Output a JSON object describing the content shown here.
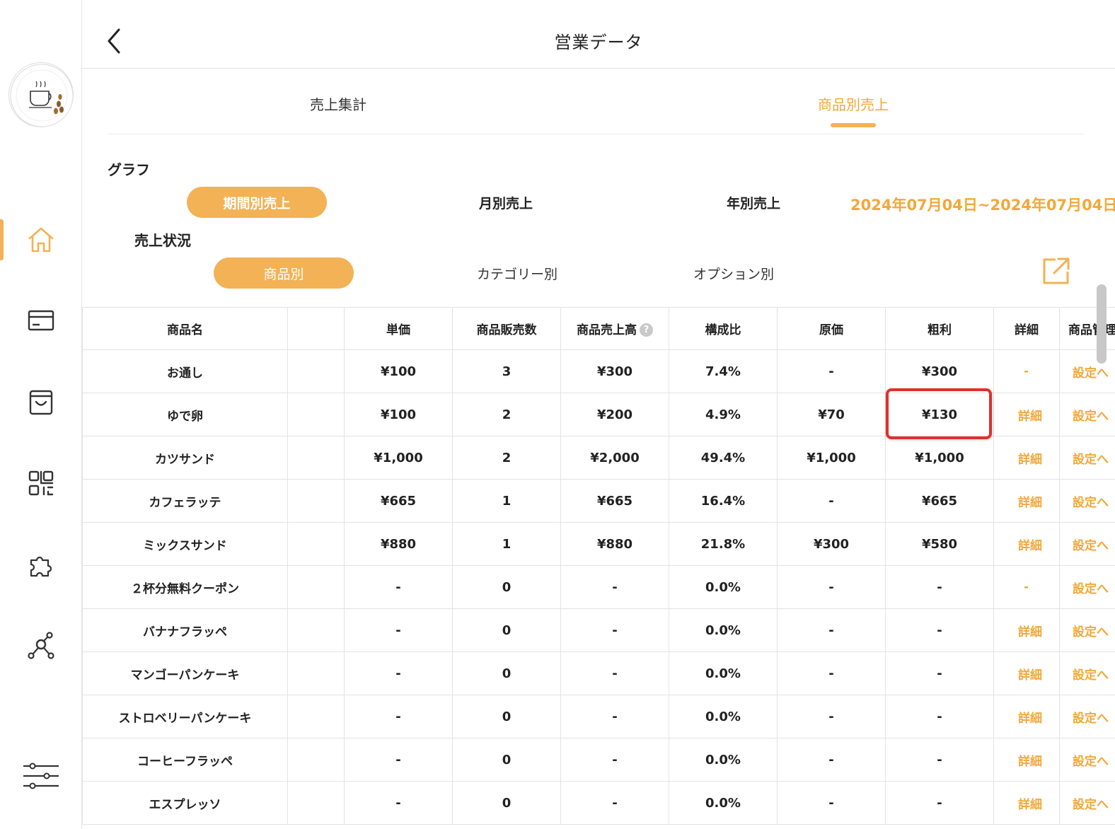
{
  "header": {
    "title": "営業データ"
  },
  "sidebar": {
    "logo_icon": "cafe-logo-icon",
    "items": [
      {
        "icon": "home-icon",
        "active": true
      },
      {
        "icon": "card-icon",
        "active": false
      },
      {
        "icon": "shopping-bag-icon",
        "active": false
      },
      {
        "icon": "qr-code-icon",
        "active": false
      },
      {
        "icon": "puzzle-icon",
        "active": false
      },
      {
        "icon": "network-icon",
        "active": false
      },
      {
        "icon": "sliders-icon",
        "active": false
      }
    ]
  },
  "tabs": {
    "sales_summary": "売上集計",
    "product_sales": "商品別売上",
    "active": "product_sales"
  },
  "graph": {
    "label": "グラフ",
    "period_button": "期間別売上",
    "monthly_button": "月別売上",
    "yearly_button": "年別売上",
    "date_range": "2024年07月04日~2024年07月04日"
  },
  "status": {
    "label": "売上状況",
    "by_product": "商品別",
    "by_category": "カテゴリー別",
    "by_option": "オプション別"
  },
  "table": {
    "headers": {
      "name": "商品名",
      "price": "単価",
      "qty": "商品販売数",
      "sales": "商品売上高",
      "ratio": "構成比",
      "cost": "原価",
      "profit": "粗利",
      "detail": "詳細",
      "manage": "商品管理"
    },
    "help_glyph": "?",
    "rows": [
      {
        "name": "お通し",
        "price": "¥100",
        "qty": "3",
        "sales": "¥300",
        "ratio": "7.4%",
        "cost": "-",
        "profit": "¥300",
        "detail": "-",
        "manage": "設定へ"
      },
      {
        "name": "ゆで卵",
        "price": "¥100",
        "qty": "2",
        "sales": "¥200",
        "ratio": "4.9%",
        "cost": "¥70",
        "profit": "¥130",
        "detail": "詳細",
        "manage": "設定へ"
      },
      {
        "name": "カツサンド",
        "price": "¥1,000",
        "qty": "2",
        "sales": "¥2,000",
        "ratio": "49.4%",
        "cost": "¥1,000",
        "profit": "¥1,000",
        "detail": "詳細",
        "manage": "設定へ"
      },
      {
        "name": "カフェラッテ",
        "price": "¥665",
        "qty": "1",
        "sales": "¥665",
        "ratio": "16.4%",
        "cost": "-",
        "profit": "¥665",
        "detail": "詳細",
        "manage": "設定へ"
      },
      {
        "name": "ミックスサンド",
        "price": "¥880",
        "qty": "1",
        "sales": "¥880",
        "ratio": "21.8%",
        "cost": "¥300",
        "profit": "¥580",
        "detail": "詳細",
        "manage": "設定へ"
      },
      {
        "name": "２杯分無料クーポン",
        "price": "-",
        "qty": "0",
        "sales": "-",
        "ratio": "0.0%",
        "cost": "-",
        "profit": "-",
        "detail": "-",
        "manage": "設定へ"
      },
      {
        "name": "バナナフラッペ",
        "price": "-",
        "qty": "0",
        "sales": "-",
        "ratio": "0.0%",
        "cost": "-",
        "profit": "-",
        "detail": "詳細",
        "manage": "設定へ"
      },
      {
        "name": "マンゴーパンケーキ",
        "price": "-",
        "qty": "0",
        "sales": "-",
        "ratio": "0.0%",
        "cost": "-",
        "profit": "-",
        "detail": "詳細",
        "manage": "設定へ"
      },
      {
        "name": "ストロベリーパンケーキ",
        "price": "-",
        "qty": "0",
        "sales": "-",
        "ratio": "0.0%",
        "cost": "-",
        "profit": "-",
        "detail": "詳細",
        "manage": "設定へ"
      },
      {
        "name": "コーヒーフラッペ",
        "price": "-",
        "qty": "0",
        "sales": "-",
        "ratio": "0.0%",
        "cost": "-",
        "profit": "-",
        "detail": "詳細",
        "manage": "設定へ"
      },
      {
        "name": "エスプレッソ",
        "price": "-",
        "qty": "0",
        "sales": "-",
        "ratio": "0.0%",
        "cost": "-",
        "profit": "-",
        "detail": "詳細",
        "manage": "設定へ"
      }
    ]
  },
  "colors": {
    "accent": "#f2b255",
    "accent_text": "#f2a83a",
    "highlight": "#e0302a"
  }
}
